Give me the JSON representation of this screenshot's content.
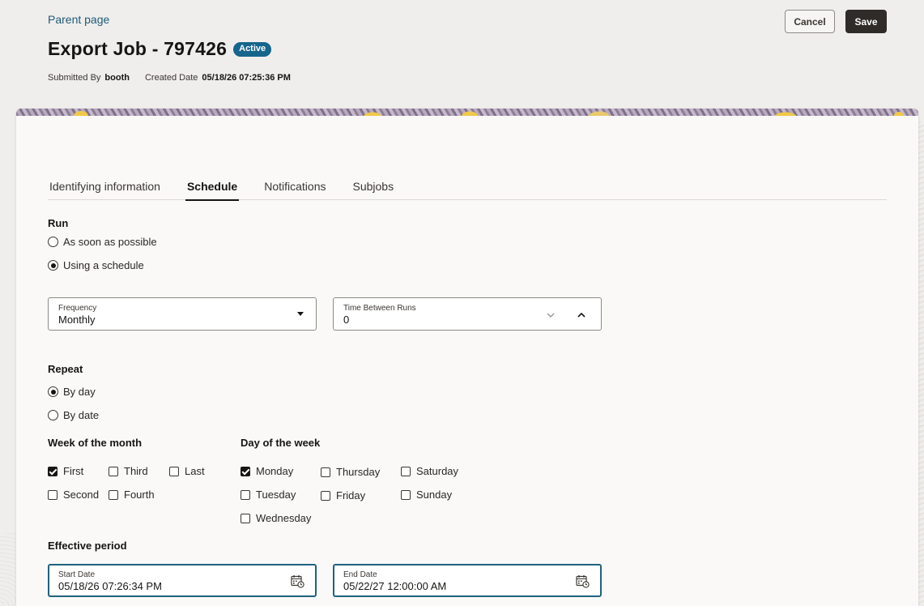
{
  "header": {
    "parent_link": "Parent page",
    "title": "Export Job - 797426",
    "status_badge": "Active",
    "submitted_by_label": "Submitted By",
    "submitted_by_value": "booth",
    "created_date_label": "Created Date",
    "created_date_value": "05/18/26 07:25:36 PM",
    "cancel_label": "Cancel",
    "save_label": "Save"
  },
  "tabs": [
    {
      "label": "Identifying information",
      "active": false
    },
    {
      "label": "Schedule",
      "active": true
    },
    {
      "label": "Notifications",
      "active": false
    },
    {
      "label": "Subjobs",
      "active": false
    }
  ],
  "run": {
    "label": "Run",
    "options": [
      {
        "label": "As soon as possible",
        "selected": false
      },
      {
        "label": "Using a schedule",
        "selected": true
      }
    ]
  },
  "frequency": {
    "label": "Frequency",
    "value": "Monthly"
  },
  "time_between_runs": {
    "label": "Time Between Runs",
    "value": "0"
  },
  "repeat": {
    "label": "Repeat",
    "options": [
      {
        "label": "By day",
        "selected": true
      },
      {
        "label": "By date",
        "selected": false
      }
    ]
  },
  "week_of_month": {
    "label": "Week of the month",
    "options": [
      {
        "label": "First",
        "checked": true
      },
      {
        "label": "Third",
        "checked": false
      },
      {
        "label": "Last",
        "checked": false
      },
      {
        "label": "Second",
        "checked": false
      },
      {
        "label": "Fourth",
        "checked": false
      }
    ]
  },
  "day_of_week": {
    "label": "Day of the week",
    "options": [
      {
        "label": "Monday",
        "checked": true
      },
      {
        "label": "Thursday",
        "checked": false
      },
      {
        "label": "Saturday",
        "checked": false
      },
      {
        "label": "Tuesday",
        "checked": false
      },
      {
        "label": "Friday",
        "checked": false
      },
      {
        "label": "Sunday",
        "checked": false
      },
      {
        "label": "Wednesday",
        "checked": false
      }
    ]
  },
  "effective_period": {
    "label": "Effective period",
    "start_label": "Start Date",
    "start_value": "05/18/26 07:26:34 PM",
    "end_label": "End Date",
    "end_value": "05/22/27 12:00:00 AM"
  },
  "icons": {
    "dropdown": "caret-down-icon",
    "stepper_down": "chevron-down-icon",
    "stepper_up": "chevron-up-icon",
    "calendar": "calendar-icon"
  },
  "colors": {
    "accent": "#15658c",
    "link": "#1e5a78",
    "primary_button": "#2e2b28",
    "focus_border": "#20627f"
  }
}
